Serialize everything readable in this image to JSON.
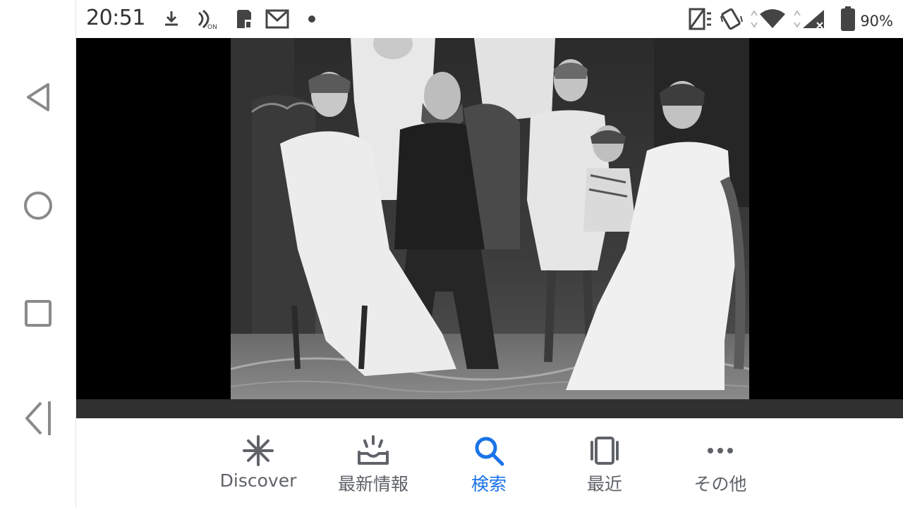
{
  "status_bar": {
    "time": "20:51",
    "battery_percent": "90%",
    "battery_level": 0.9,
    "icons": [
      "download-icon",
      "nfc-on-icon",
      "sd-card-icon",
      "gmail-icon",
      "notification-dot-icon",
      "nfc-tag-icon",
      "vibrate-icon",
      "wifi-icon",
      "signal-icon",
      "battery-icon"
    ]
  },
  "nav_rail": {
    "buttons": [
      "back-icon",
      "home-icon",
      "recents-icon",
      "side-panel-icon"
    ]
  },
  "viewer": {
    "content": "black-and-white family portrait photograph"
  },
  "bottom_nav": {
    "tabs": [
      {
        "label": "Discover",
        "icon": "asterisk-icon",
        "active": false
      },
      {
        "label": "最新情報",
        "icon": "inbox-updates-icon",
        "active": false
      },
      {
        "label": "検索",
        "icon": "search-icon",
        "active": true
      },
      {
        "label": "最近",
        "icon": "recent-cards-icon",
        "active": false
      },
      {
        "label": "その他",
        "icon": "more-dots-icon",
        "active": false
      }
    ]
  },
  "colors": {
    "accent": "#1a73e8",
    "inactive": "#5f6368",
    "viewer_background": "#000000",
    "band": "#303030"
  }
}
